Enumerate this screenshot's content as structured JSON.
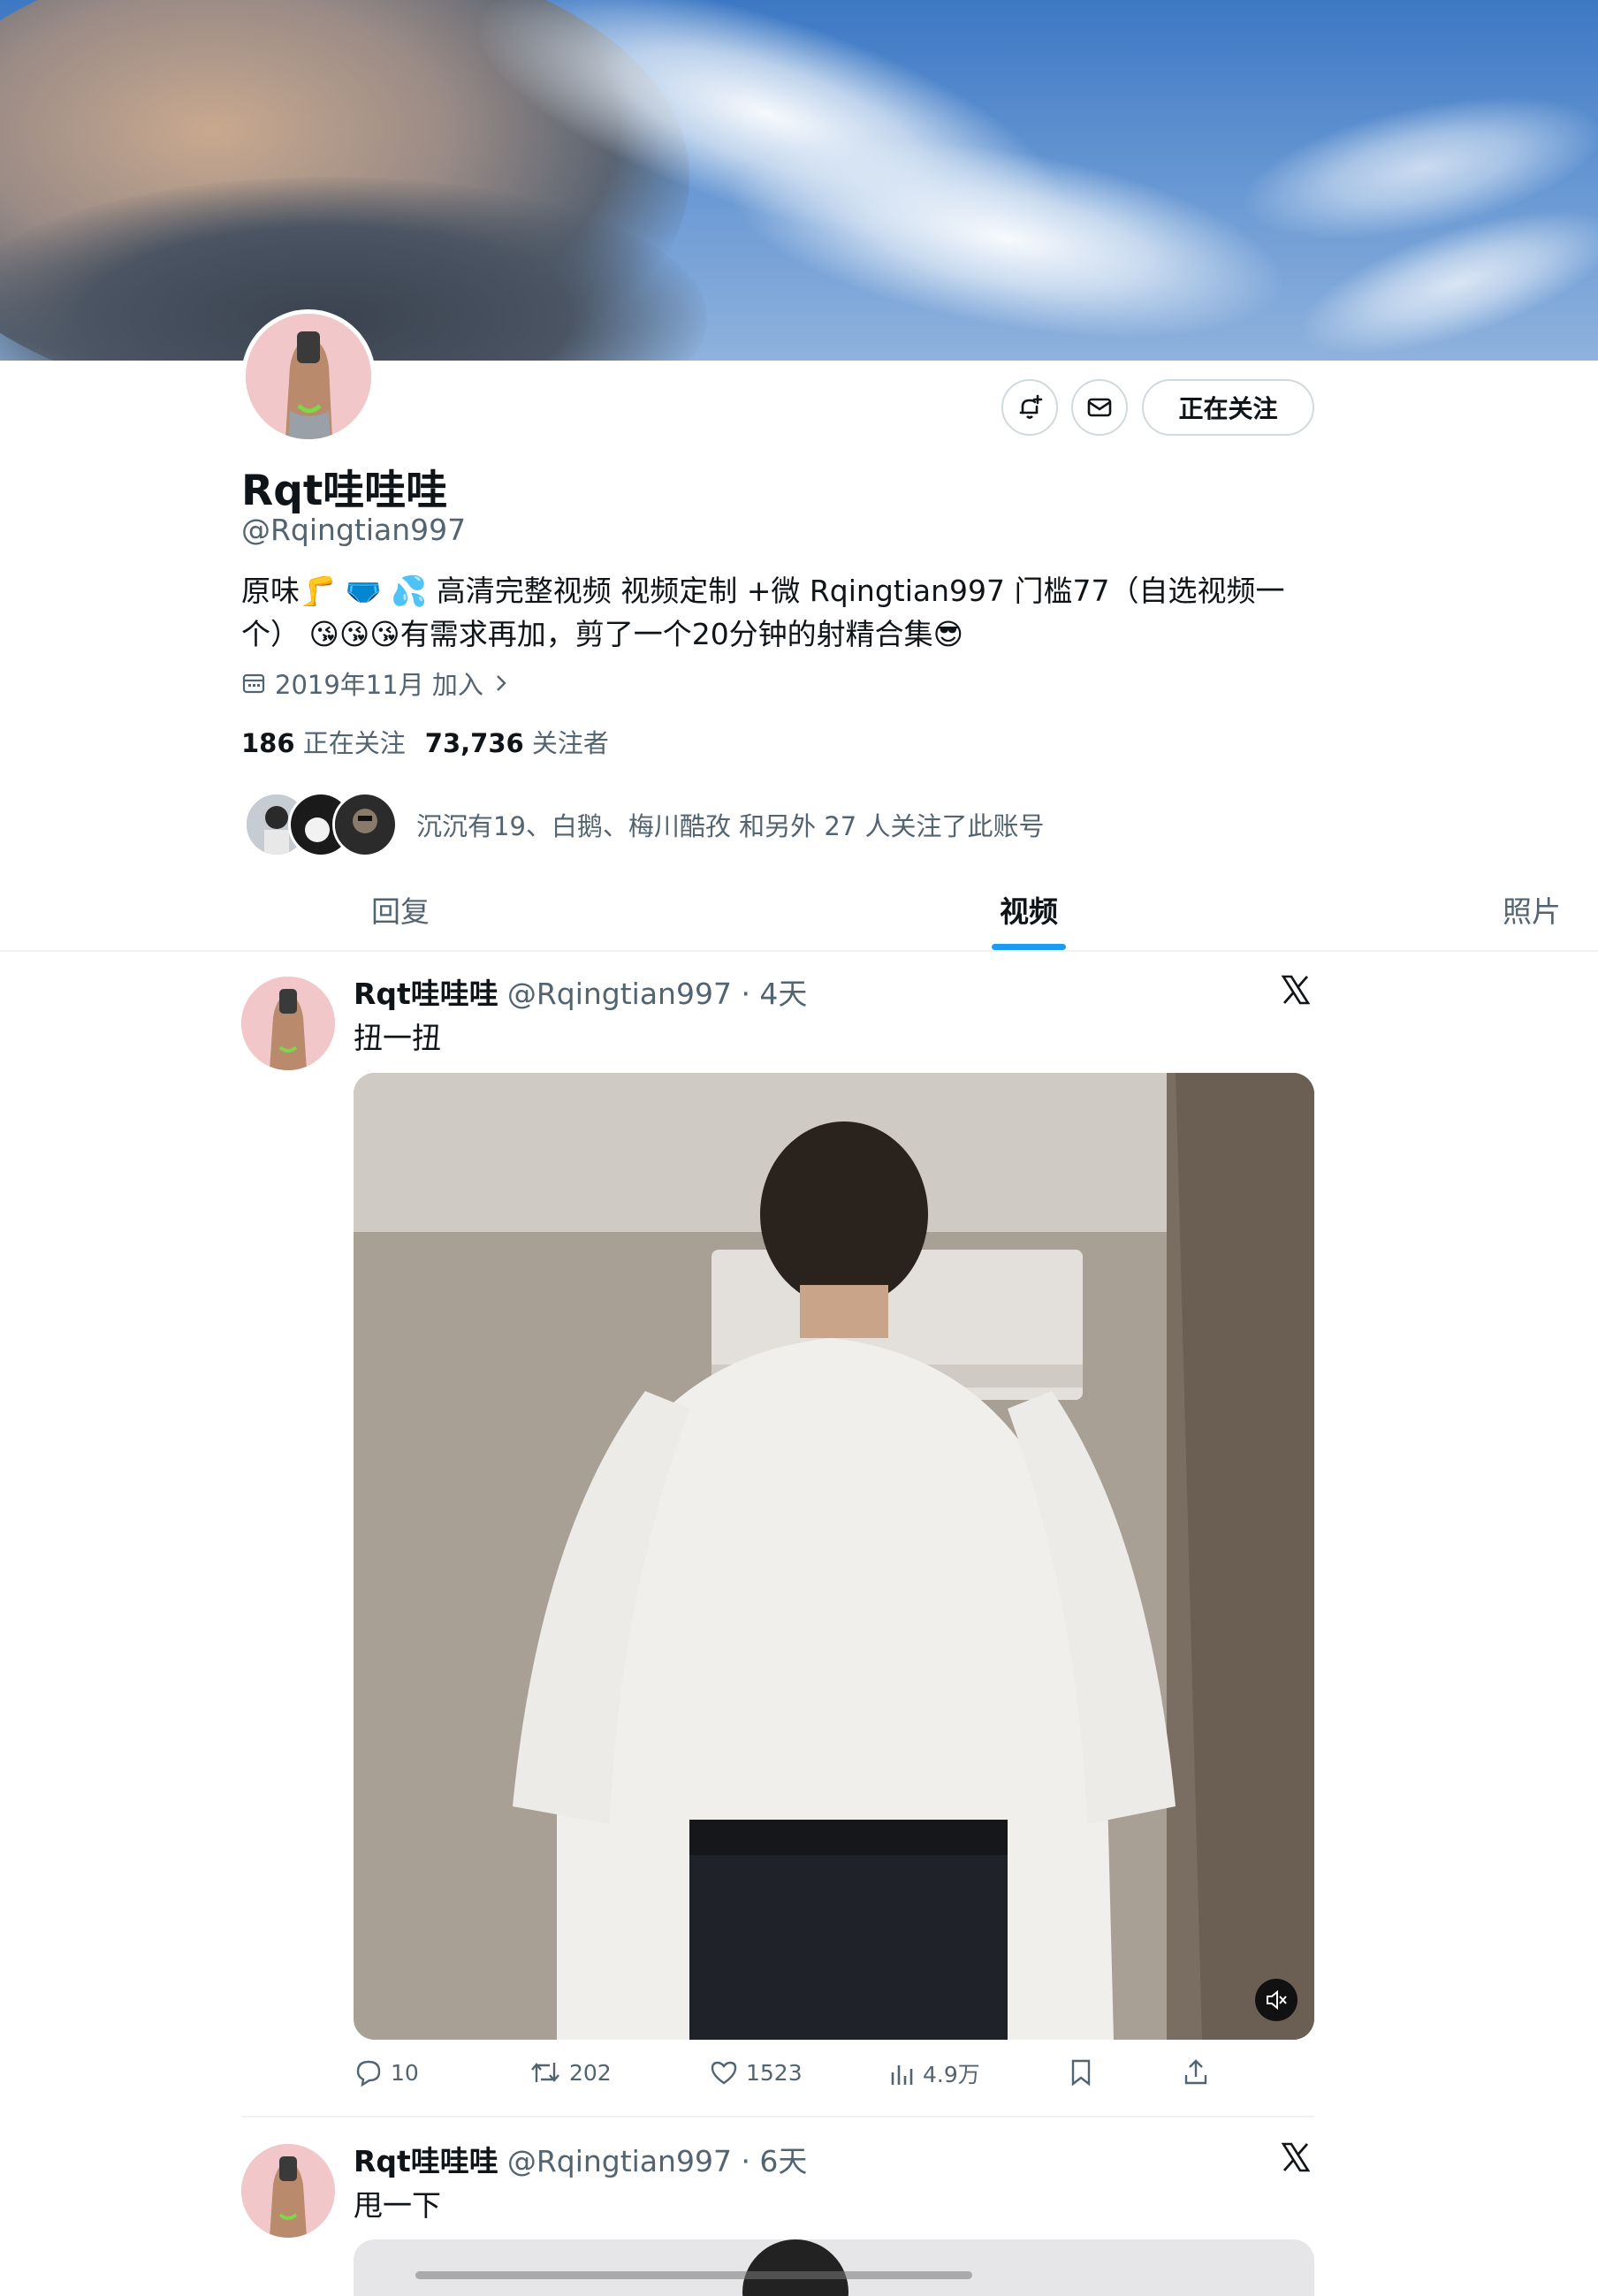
{
  "profile": {
    "name": "Rqt哇哇哇",
    "handle": "@Rqingtian997",
    "bio": "原味🦵 🩲 💦 高清完整视频 视频定制 +微 Rqingtian997 门槛77（自选视频一个） 😘😘😘有需求再加，剪了一个20分钟的射精合集😎",
    "joined": "2019年11月 加入",
    "following_count": "186",
    "following_label": "正在关注",
    "followers_count": "73,736",
    "followers_label": "关注者",
    "followed_by": "沉沉有19、白鹅、梅川酷孜 和另外 27 人关注了此账号",
    "follow_button": "正在关注"
  },
  "tabs": [
    {
      "label": "回复"
    },
    {
      "label": "视频",
      "active": true
    },
    {
      "label": "照片"
    }
  ],
  "posts": [
    {
      "name": "Rqt哇哇哇",
      "meta": "@Rqingtian997 · 4天",
      "text": "扭一扭",
      "replies": "10",
      "reposts": "202",
      "likes": "1523",
      "views": "4.9万"
    },
    {
      "name": "Rqt哇哇哇",
      "meta": "@Rqingtian997 · 6天",
      "text": "甩一下"
    }
  ],
  "icons": {
    "notify": "bell-plus-icon",
    "message": "envelope-icon",
    "calendar": "calendar-icon",
    "x_logo": "x-logo-icon",
    "mute": "speaker-muted-icon"
  },
  "colors": {
    "accent": "#1d9bf0",
    "text": "#0f1419",
    "secondary": "#536471",
    "border": "#cfd9de"
  }
}
